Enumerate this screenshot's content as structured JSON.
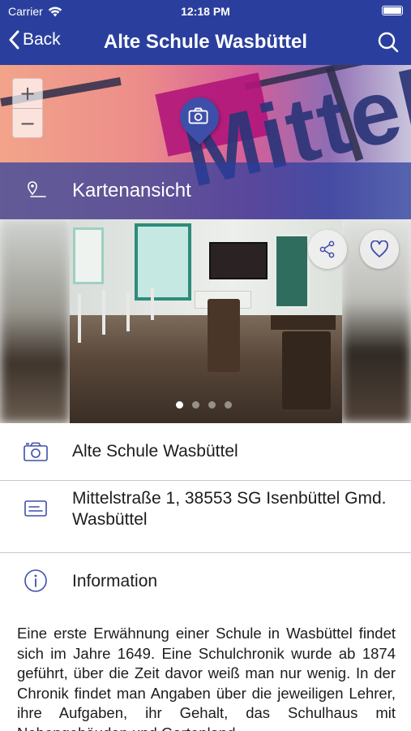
{
  "status_bar": {
    "carrier": "Carrier",
    "time": "12:18 PM"
  },
  "nav": {
    "back_label": "Back",
    "title": "Alte Schule Wasbüttel",
    "search_icon": "search-icon"
  },
  "map": {
    "zoom_in": "+",
    "zoom_out": "−",
    "street_label": "Mittelstr",
    "view_label": "Kartenansicht",
    "pin_icon": "camera-pin-icon"
  },
  "gallery": {
    "image_count": 4,
    "active_index": 0,
    "share_icon": "share-icon",
    "favorite_icon": "heart-icon"
  },
  "details": {
    "name": "Alte Schule Wasbüttel",
    "address_line1": "Mittelstraße 1, 38553 SG Isenbüttel Gmd.",
    "address_line2": "Wasbüttel",
    "info_heading": "Information",
    "description": "Eine erste Erwähnung einer Schule in Wasbüttel findet sich im Jahre 1649. Eine Schulchronik wurde ab 1874 geführt, über die Zeit davor weiß man nur wenig. In der Chronik findet man Angaben über die jeweiligen Lehrer, ihre Aufgaben, ihr Gehalt, das Schulhaus mit Nebengebäuden und Gartenland."
  },
  "colors": {
    "brand": "#2a3f9d",
    "icon": "#3e4fa9",
    "divider": "#c8c8cc"
  }
}
